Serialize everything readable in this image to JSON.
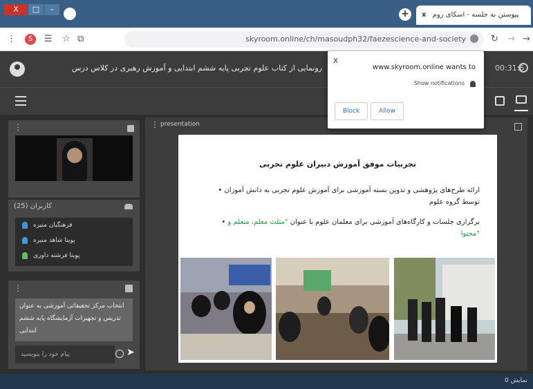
{
  "browser": {
    "window_buttons": {
      "close": "X",
      "maximize": "□",
      "minimize": "–"
    },
    "inactive_tab_title": "",
    "new_tab_label": "+",
    "active_tab_title": "پیوستن به جلسه - اسکای روم",
    "active_tab_close": "x",
    "url": "skyroom.online/ch/masoudph32/faezescience-and-society",
    "profile_letter": "S"
  },
  "app_header": {
    "title": "رونمایی از کتاب علوم تجربی پایه ششم ابتدایی و آموزش رهبری در کلاس درس",
    "time": "00:31:6"
  },
  "sidebar": {
    "users_title": "کاربران (25)",
    "users": [
      {
        "name": "فرهنگیان منیره"
      },
      {
        "name": "پوینا شاهد منیره"
      },
      {
        "name": "پوینا فرشته داوری"
      }
    ],
    "chat_message": "انتخاب مرکز تحقیقاتی آموزشی به عنوان تدریس و تجهیزات آزمایشگاه پایه ششم ابتدایی",
    "chat_placeholder": "پیام خود را بنویسید"
  },
  "slide_panel": {
    "label": "presentation",
    "heading": "تجربیات موفق آموزش دبیران علوم تجربی",
    "bullet_1": "• ارائه طرح‌های پژوهشی و تدوین بسته آموزشی برای آموزش علوم تجربی به دانش آموزان توسط گروه علوم",
    "bullet_2": "• برگزاری جلسات و کارگاه‌های آموزشی برای معلمان علوم با عنوان ",
    "bullet_2_green": "\"مثلث معلم، متعلم و محتوا\""
  },
  "notification": {
    "site": "www.skyroom.online wants to",
    "body": "Show notifications",
    "allow_label": "Allow",
    "block_label": "Block",
    "close": "x"
  },
  "status_bar": {
    "text": "0 نمایش"
  },
  "colors": {
    "tab_bar": "#3a5f86",
    "app_dark": "#3c3c3c",
    "panel": "#474747",
    "accent_green": "#1f9b45"
  }
}
